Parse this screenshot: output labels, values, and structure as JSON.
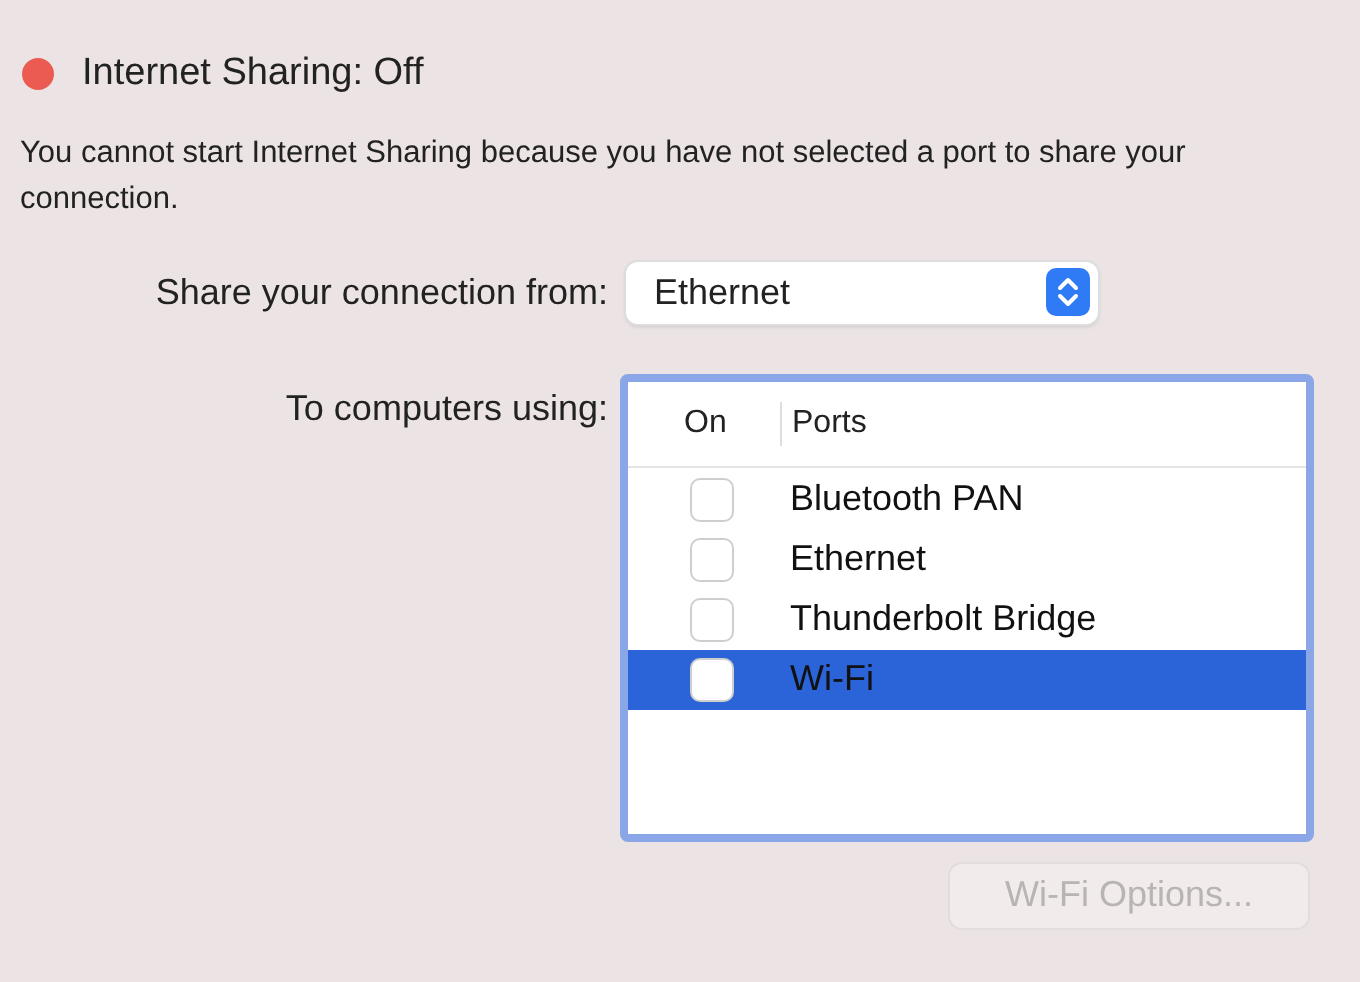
{
  "status": {
    "title": "Internet Sharing: Off",
    "on": false
  },
  "message": "You cannot start Internet Sharing because you have not selected a port to share your connection.",
  "share_from": {
    "label": "Share your connection from:",
    "value": "Ethernet"
  },
  "to_computers": {
    "label": "To computers using:",
    "columns": [
      "On",
      "Ports"
    ],
    "ports": [
      {
        "name": "Bluetooth PAN",
        "checked": false,
        "selected": false
      },
      {
        "name": "Ethernet",
        "checked": false,
        "selected": false
      },
      {
        "name": "Thunderbolt Bridge",
        "checked": false,
        "selected": false
      },
      {
        "name": "Wi-Fi",
        "checked": false,
        "selected": true
      }
    ]
  },
  "options_button": {
    "label": "Wi-Fi Options...",
    "disabled": true
  }
}
